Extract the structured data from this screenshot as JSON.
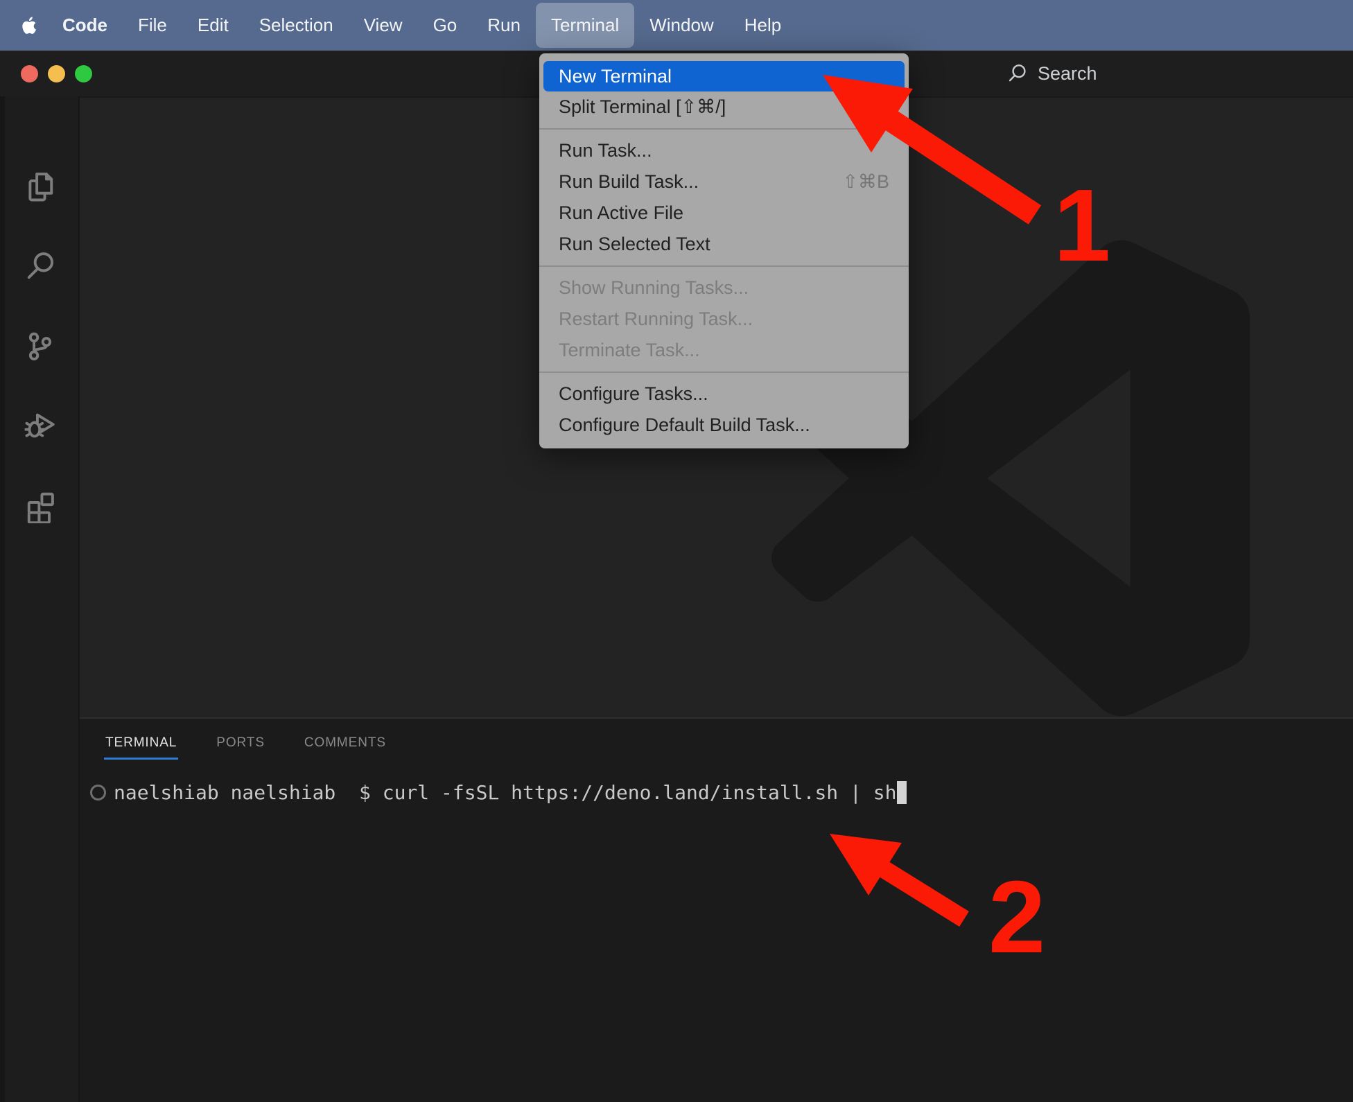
{
  "menubar": {
    "app_name": "Code",
    "items": [
      "File",
      "Edit",
      "Selection",
      "View",
      "Go",
      "Run",
      "Terminal",
      "Window",
      "Help"
    ],
    "active_item": "Terminal"
  },
  "titlebar": {
    "search_label": "Search",
    "traffic_lights": [
      "close",
      "minimize",
      "zoom"
    ]
  },
  "activity_bar": {
    "icons": [
      "explorer",
      "search",
      "source-control",
      "run-and-debug",
      "extensions"
    ]
  },
  "terminal_menu": {
    "groups": [
      {
        "items": [
          {
            "label": "New Terminal",
            "selected": true
          },
          {
            "label": "Split Terminal [⇧⌘/]"
          }
        ]
      },
      {
        "items": [
          {
            "label": "Run Task..."
          },
          {
            "label": "Run Build Task...",
            "shortcut": "⇧⌘B"
          },
          {
            "label": "Run Active File"
          },
          {
            "label": "Run Selected Text"
          }
        ]
      },
      {
        "items": [
          {
            "label": "Show Running Tasks...",
            "disabled": true
          },
          {
            "label": "Restart Running Task...",
            "disabled": true
          },
          {
            "label": "Terminate Task...",
            "disabled": true
          }
        ]
      },
      {
        "items": [
          {
            "label": "Configure Tasks..."
          },
          {
            "label": "Configure Default Build Task..."
          }
        ]
      }
    ]
  },
  "panel": {
    "tabs": [
      {
        "label": "TERMINAL",
        "active": true
      },
      {
        "label": "PORTS",
        "active": false
      },
      {
        "label": "COMMENTS",
        "active": false
      }
    ],
    "command_line": "naelshiab naelshiab  $ curl -fsSL https://deno.land/install.sh | sh"
  },
  "annotations": {
    "steps": [
      {
        "label": "1"
      },
      {
        "label": "2"
      }
    ]
  },
  "colors": {
    "menubar_bg": "#556a8e",
    "menu_highlight_blue": "#0f64d2",
    "arrow_red": "#fb1a06",
    "tab_underline_blue": "#2e7cd6",
    "traffic_red": "#ee6a5f",
    "traffic_yellow": "#f5bf4f",
    "traffic_green": "#2fc841"
  }
}
